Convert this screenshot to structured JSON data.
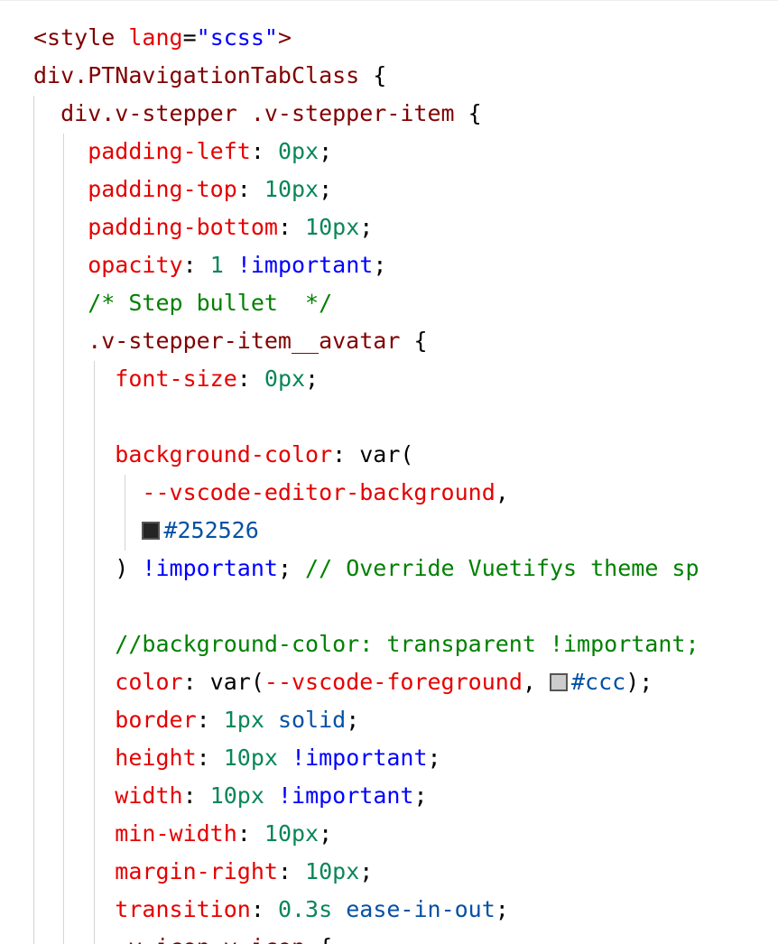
{
  "lines": [
    [
      [
        "tag",
        "<style "
      ],
      [
        "attr",
        "lang"
      ],
      [
        "plain",
        "="
      ],
      [
        "str",
        "\"scss\""
      ],
      [
        "tag",
        ">"
      ]
    ],
    [
      [
        "sel",
        "div.PTNavigationTabClass"
      ],
      [
        "plain",
        " {"
      ]
    ],
    [
      [
        "sel",
        "  div.v-stepper .v-stepper-item"
      ],
      [
        "plain",
        " {"
      ]
    ],
    [
      [
        "prop",
        "    padding-left"
      ],
      [
        "plain",
        ": "
      ],
      [
        "num",
        "0px"
      ],
      [
        "plain",
        ";"
      ]
    ],
    [
      [
        "prop",
        "    padding-top"
      ],
      [
        "plain",
        ": "
      ],
      [
        "num",
        "10px"
      ],
      [
        "plain",
        ";"
      ]
    ],
    [
      [
        "prop",
        "    padding-bottom"
      ],
      [
        "plain",
        ": "
      ],
      [
        "num",
        "10px"
      ],
      [
        "plain",
        ";"
      ]
    ],
    [
      [
        "prop",
        "    opacity"
      ],
      [
        "plain",
        ": "
      ],
      [
        "num",
        "1"
      ],
      [
        "plain",
        " "
      ],
      [
        "kw",
        "!important"
      ],
      [
        "plain",
        ";"
      ]
    ],
    [
      [
        "cmt",
        "    /* Step bullet  */"
      ]
    ],
    [
      [
        "sel",
        "    .v-stepper-item__avatar"
      ],
      [
        "plain",
        " {"
      ]
    ],
    [
      [
        "prop",
        "      font-size"
      ],
      [
        "plain",
        ": "
      ],
      [
        "num",
        "0px"
      ],
      [
        "plain",
        ";"
      ]
    ],
    [],
    [
      [
        "prop",
        "      background-color"
      ],
      [
        "plain",
        ": var("
      ]
    ],
    [
      [
        "var",
        "        --vscode-editor-background"
      ],
      [
        "plain",
        ","
      ]
    ],
    [
      [
        "plain",
        "        "
      ],
      [
        "swatch",
        "#252526"
      ],
      [
        "hex",
        "#252526"
      ]
    ],
    [
      [
        "plain",
        "      ) "
      ],
      [
        "kw",
        "!important"
      ],
      [
        "plain",
        "; "
      ],
      [
        "cmt",
        "// Override Vuetifys theme sp"
      ]
    ],
    [],
    [
      [
        "cmt",
        "      //background-color: transparent !important;"
      ]
    ],
    [
      [
        "prop",
        "      color"
      ],
      [
        "plain",
        ": var("
      ],
      [
        "var",
        "--vscode-foreground"
      ],
      [
        "plain",
        ", "
      ],
      [
        "swatch",
        "#cccccc"
      ],
      [
        "hex",
        "#ccc"
      ],
      [
        "plain",
        ");"
      ]
    ],
    [
      [
        "prop",
        "      border"
      ],
      [
        "plain",
        ": "
      ],
      [
        "num",
        "1px"
      ],
      [
        "plain",
        " "
      ],
      [
        "val",
        "solid"
      ],
      [
        "plain",
        ";"
      ]
    ],
    [
      [
        "prop",
        "      height"
      ],
      [
        "plain",
        ": "
      ],
      [
        "num",
        "10px"
      ],
      [
        "plain",
        " "
      ],
      [
        "kw",
        "!important"
      ],
      [
        "plain",
        ";"
      ]
    ],
    [
      [
        "prop",
        "      width"
      ],
      [
        "plain",
        ": "
      ],
      [
        "num",
        "10px"
      ],
      [
        "plain",
        " "
      ],
      [
        "kw",
        "!important"
      ],
      [
        "plain",
        ";"
      ]
    ],
    [
      [
        "prop",
        "      min-width"
      ],
      [
        "plain",
        ": "
      ],
      [
        "num",
        "10px"
      ],
      [
        "plain",
        ";"
      ]
    ],
    [
      [
        "prop",
        "      margin-right"
      ],
      [
        "plain",
        ": "
      ],
      [
        "num",
        "10px"
      ],
      [
        "plain",
        ";"
      ]
    ],
    [
      [
        "prop",
        "      transition"
      ],
      [
        "plain",
        ": "
      ],
      [
        "num",
        "0.3s"
      ],
      [
        "plain",
        " "
      ],
      [
        "val",
        "ease-in-out"
      ],
      [
        "plain",
        ";"
      ]
    ],
    [
      [
        "sel",
        "      .v-icon.v-icon"
      ],
      [
        "plain",
        " {"
      ]
    ]
  ]
}
